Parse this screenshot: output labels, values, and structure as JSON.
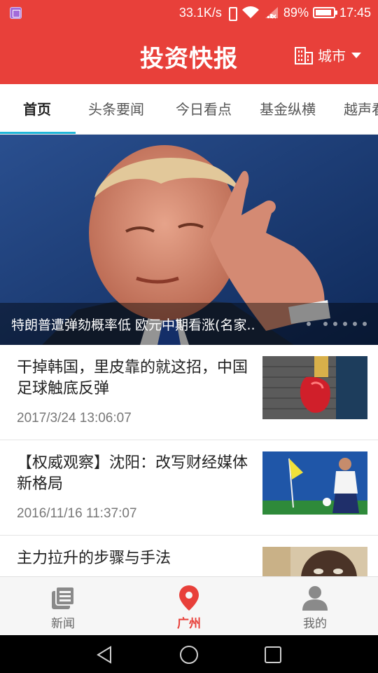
{
  "status_bar": {
    "speed": "33.1K/s",
    "battery": "89%",
    "time": "17:45",
    "icons": [
      "gallery-icon",
      "vibrate-icon",
      "wifi-icon",
      "signal-icon",
      "battery-icon"
    ]
  },
  "header": {
    "title": "投资快报",
    "city_label": "城市",
    "colors": {
      "primary": "#e8403a",
      "tab_indicator": "#20b6d8"
    }
  },
  "tabs": [
    {
      "label": "首页",
      "active": true
    },
    {
      "label": "头条要闻",
      "active": false
    },
    {
      "label": "今日看点",
      "active": false
    },
    {
      "label": "基金纵横",
      "active": false
    },
    {
      "label": "越声看",
      "active": false
    }
  ],
  "banner": {
    "caption": "特朗普遭弹劾概率低 欧元中期看涨(名家..",
    "slide_count": 6,
    "active_slide": 1
  },
  "news": [
    {
      "title": "干掉韩国，里皮靠的就这招，中国足球触底反弹",
      "time": "2017/3/24 13:06:07",
      "thumb": "boxing-glove"
    },
    {
      "title": "【权威观察】沈阳：改写财经媒体新格局",
      "time": "2016/11/16 11:37:07",
      "thumb": "soccer-player"
    },
    {
      "title": "主力拉升的步骤与手法",
      "time": "",
      "thumb": "portrait"
    }
  ],
  "bottom_nav": [
    {
      "label": "新闻",
      "icon": "news-icon",
      "active": false
    },
    {
      "label": "广州",
      "icon": "location-pin-icon",
      "active": true
    },
    {
      "label": "我的",
      "icon": "user-icon",
      "active": false
    }
  ],
  "system_nav": [
    "back-icon",
    "home-icon",
    "recents-icon"
  ]
}
